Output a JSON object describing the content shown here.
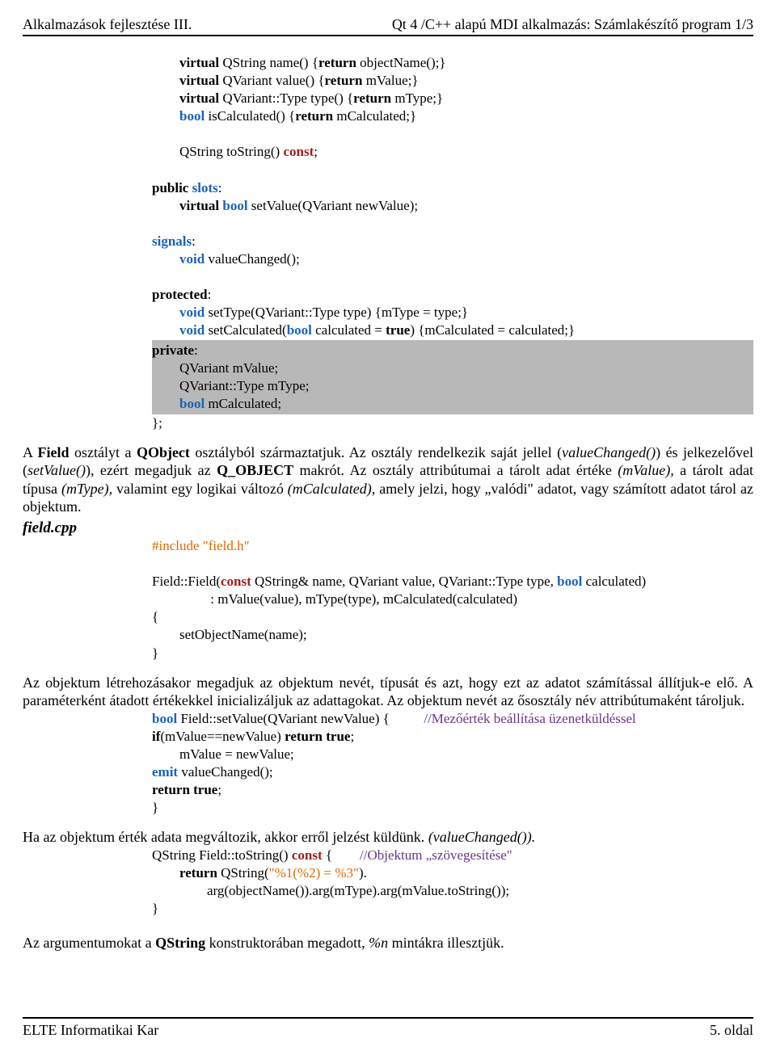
{
  "header": {
    "left": "Alkalmazások fejlesztése III.",
    "right": "Qt 4 /C++ alapú MDI alkalmazás: Számlakészítő program 1/3"
  },
  "code1": {
    "l1a": "virtual",
    "l1b": " QString name() {",
    "l1c": "return",
    "l1d": " objectName();}",
    "l2a": "virtual",
    "l2b": " QVariant value() {",
    "l2c": "return",
    "l2d": " mValue;}",
    "l3a": "virtual",
    "l3b": " QVariant::Type type() {",
    "l3c": "return",
    "l3d": " mType;}",
    "l4a": "bool",
    "l4b": " isCalculated() {",
    "l4c": "return",
    "l4d": " mCalculated;}",
    "l5a": "QString toString() ",
    "l5b": "const",
    "l5c": ";",
    "l6a": "public",
    "l6b": " slots",
    "l6c": ":",
    "l7a": "virtual",
    "l7b": " ",
    "l7c": "bool",
    "l7d": " setValue(QVariant newValue);",
    "l8a": "signals",
    "l8b": ":",
    "l9a": "void",
    "l9b": " valueChanged();",
    "l10a": "protected",
    "l10b": ":",
    "l11a": "void",
    "l11b": " setType(QVariant::Type type) {mType = type;}",
    "l12a": "void",
    "l12b": " setCalculated(",
    "l12c": "bool",
    "l12d": " calculated = ",
    "l12e": "true",
    "l12f": ") {mCalculated = calculated;}",
    "p1a": "private",
    "p1b": ":",
    "p2": "QVariant mValue;",
    "p3": "QVariant::Type mType;",
    "p4a": "bool",
    "p4b": " mCalculated;",
    "p5": "};"
  },
  "para1": {
    "t1": "A ",
    "t2": "Field",
    "t3": " osztályt a ",
    "t4": "QObject",
    "t5": " osztályból származtatjuk. Az osztály rendelkezik saját jellel (",
    "t6": "valueChanged()",
    "t7": ") és jelkezelővel (",
    "t8": "setValue()",
    "t9": "), ezért megadjuk az ",
    "t10": "Q_OBJECT",
    "t11": " makrót. Az osztály attribútumai a tárolt adat értéke ",
    "t12": "(mValue),",
    "t13": " a tárolt adat típusa ",
    "t14": "(mType),",
    "t15": "  valamint egy logikai változó ",
    "t16": "(mCalculated),",
    "t17": " amely jelzi, hogy „valódi\" adatot, vagy számított adatot tárol az objektum."
  },
  "sec": "field.cpp",
  "code2": {
    "inc1": "#include ",
    "inc2": "\"field.h\"",
    "l1a": "Field::Field(",
    "l1b": "const",
    "l1c": " QString& name, QVariant value, QVariant::Type type, ",
    "l1d": "bool",
    "l1e": " calculated)",
    "l2": "                 : mValue(value), mType(type), mCalculated(calculated)",
    "l3": "{",
    "l4": "        setObjectName(name);",
    "l5": "}"
  },
  "para2": "Az objektum létrehozásakor megadjuk az objektum nevét, típusát és azt, hogy ezt az adatot számítással állítjuk-e elő. A paraméterként átadott értékekkel inicializáljuk az adattagokat. Az objektum nevét az ősosztály név attribútumaként tároljuk.",
  "code3": {
    "l1a": "bool",
    "l1b": " Field::setValue(QVariant newValue) {          ",
    "l1c": "//Mezőérték beállítása üzenetküldéssel",
    "l2a": "if",
    "l2b": "(mValue==newValue) ",
    "l2c": "return true",
    "l2d": ";",
    "l3": "        mValue = newValue;",
    "l4a": "emit",
    "l4b": " valueChanged();",
    "l5a": "return true",
    "l5b": ";",
    "l6": "}"
  },
  "para3": {
    "t1": "Ha az objektum érték adata megváltozik, akkor erről jelzést küldünk. ",
    "t2": "(valueChanged())."
  },
  "code4": {
    "l1a": "QString Field::toString() ",
    "l1b": "const",
    "l1c": " {        ",
    "l1d": "//Objektum „szövegesítése\"",
    "l2a": "return",
    "l2b": " QString(",
    "l2c": "\"%1(%2) = %3\"",
    "l2d": ").",
    "l3": "                arg(objectName()).arg(mType).arg(mValue.toString());",
    "l4": "}"
  },
  "para4": {
    "t1": "Az argumentumokat a ",
    "t2": "QString",
    "t3": " konstruktorában megadott, ",
    "t4": "%n",
    "t5": " mintákra illesztjük."
  },
  "footer": {
    "left": "ELTE Informatikai Kar",
    "right": "5. oldal"
  }
}
